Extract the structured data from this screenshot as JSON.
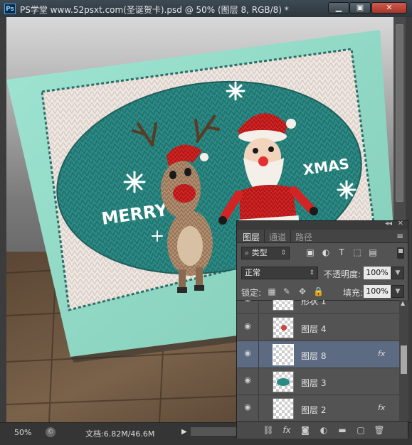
{
  "window": {
    "title": "PS学堂 www.52psxt.com(圣诞贺卡).psd @ 50% (图层 8, RGB/8) *",
    "app_icon": "Ps",
    "minimize_icon": "minimize-icon",
    "maximize_icon": "maximize-icon",
    "close_icon": "close-icon"
  },
  "canvas": {
    "merry_text": "MERRY",
    "xmas_text": "XMAS"
  },
  "status": {
    "zoom": "50%",
    "doc_info": "文档:6.82M/46.6M"
  },
  "layers_panel": {
    "tabs": [
      "图层",
      "通道",
      "路径"
    ],
    "active_tab": "图层",
    "kind_filter": "类型",
    "blend_mode": "正常",
    "opacity_label": "不透明度:",
    "opacity_value": "100%",
    "lock_label": "锁定:",
    "fill_label": "填充:",
    "fill_value": "100%",
    "layers": [
      {
        "name": "形状 1",
        "fx": false,
        "selected": false
      },
      {
        "name": "图层 4",
        "fx": false,
        "selected": false
      },
      {
        "name": "图层 8",
        "fx": true,
        "selected": true
      },
      {
        "name": "图层 3",
        "fx": false,
        "selected": false
      },
      {
        "name": "图层 2",
        "fx": true,
        "selected": false
      }
    ],
    "fx_label": "fx"
  },
  "colors": {
    "card_mint": "#8fd8c4",
    "knit_teal": "#2d8b86",
    "knit_white": "#f2ece6",
    "santa_red": "#c81e1e",
    "reindeer_tan": "#b08a6a",
    "selection_blue": "#5c6b82"
  }
}
